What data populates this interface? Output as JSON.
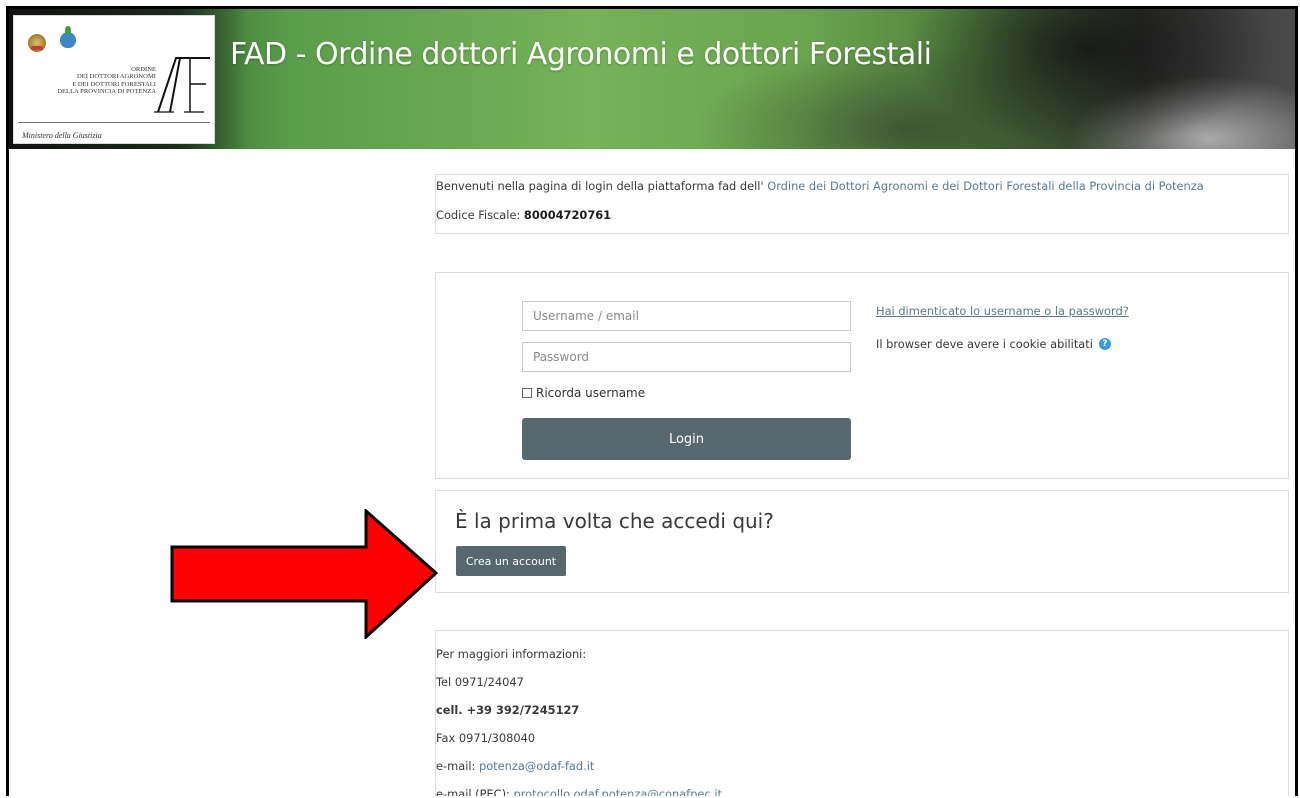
{
  "header": {
    "site_title": "FAD - Ordine dottori Agronomi e dottori Forestali",
    "logo": {
      "org_lines": [
        "ORDINE",
        "DEI DOTTORI AGRONOMI",
        "E DEI DOTTORI FORESTALI",
        "DELLA PROVINCIA DI POTENZA"
      ],
      "ministero": "Ministero della Giustizia"
    }
  },
  "welcome": {
    "intro_text": "Benvenuti nella pagina di login della piattaforma fad dell'",
    "org_link": "Ordine dei Dottori Agronomi e dei Dottori Forestali della Provincia di Potenza",
    "codice_label": "Codice Fiscale:",
    "codice_value": "80004720761"
  },
  "login": {
    "username_placeholder": "Username / email",
    "password_placeholder": "Password",
    "remember_label": "Ricorda username",
    "login_button": "Login",
    "forgot_link": "Hai dimenticato lo username o la password?",
    "cookie_text": "Il browser deve avere i cookie abilitati"
  },
  "first_time": {
    "heading": "È la prima volta che accedi qui?",
    "create_button": "Crea un account"
  },
  "info": {
    "title": "Per maggiori informazioni:",
    "tel": "Tel 0971/24047",
    "cell": "cell. +39 392/7245127",
    "fax": "Fax 0971/308040",
    "email_label": "e-mail: ",
    "email_value": "potenza@odaf-fad.it",
    "pec_label": "e-mail (PEC): ",
    "pec_value": "protocollo.odaf.potenza@conafpec.it"
  },
  "stray_char": "(",
  "colors": {
    "button": "#56676d",
    "link": "#5a7a93",
    "arrow_fill": "#ff0000",
    "help_icon": "#3a9bd6"
  }
}
